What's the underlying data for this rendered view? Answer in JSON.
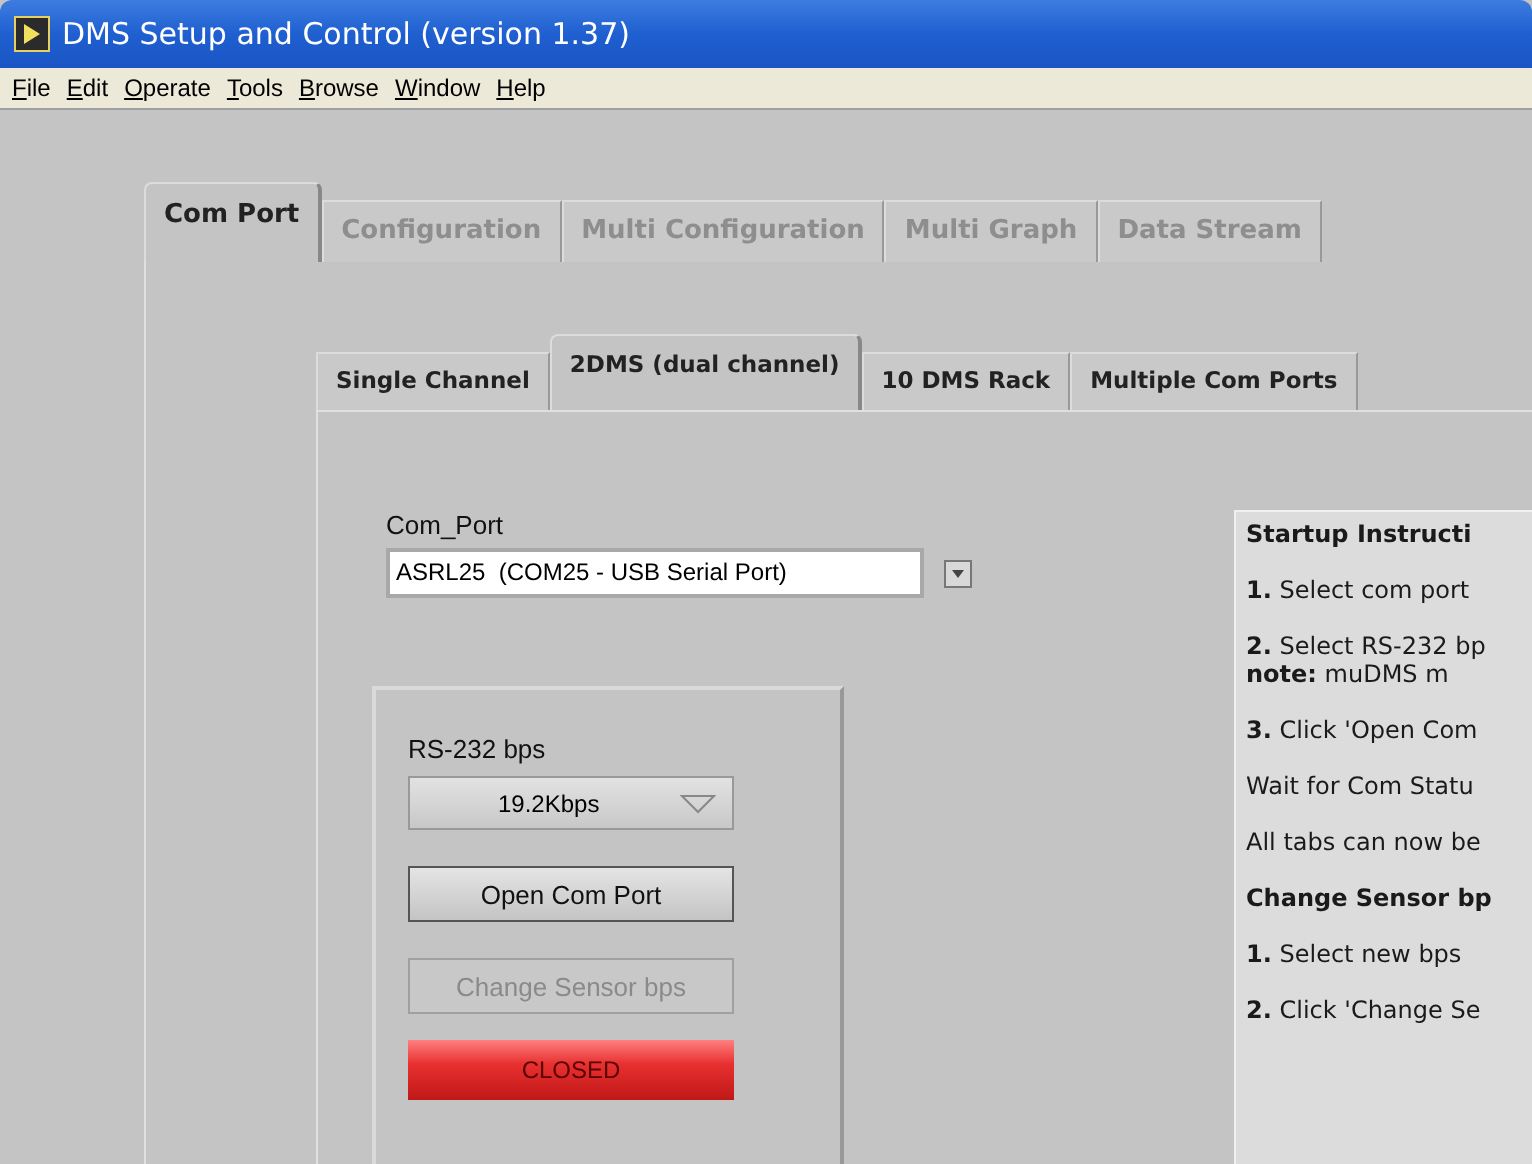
{
  "window": {
    "title": "DMS Setup and Control (version 1.37)"
  },
  "menu": [
    {
      "label": "File"
    },
    {
      "label": "Edit"
    },
    {
      "label": "Operate"
    },
    {
      "label": "Tools"
    },
    {
      "label": "Browse"
    },
    {
      "label": "Window"
    },
    {
      "label": "Help"
    }
  ],
  "tabs": [
    {
      "label": "Com Port",
      "selected": true,
      "disabled": false
    },
    {
      "label": "Configuration",
      "selected": false,
      "disabled": true
    },
    {
      "label": "Multi Configuration",
      "selected": false,
      "disabled": true
    },
    {
      "label": "Multi Graph",
      "selected": false,
      "disabled": true
    },
    {
      "label": "Data Stream",
      "selected": false,
      "disabled": true
    }
  ],
  "subtabs": [
    {
      "label": "Single Channel",
      "selected": false
    },
    {
      "label": "2DMS (dual channel)",
      "selected": true
    },
    {
      "label": "10 DMS Rack",
      "selected": false
    },
    {
      "label": "Multiple Com Ports",
      "selected": false
    }
  ],
  "com_port": {
    "label": "Com_Port",
    "value": "ASRL25  (COM25 - USB Serial Port)"
  },
  "bps": {
    "label": "RS-232 bps",
    "value": "19.2Kbps"
  },
  "buttons": [
    {
      "label": "Open Com Port",
      "disabled": false
    },
    {
      "label": "Change Sensor bps",
      "disabled": true
    }
  ],
  "status": {
    "label": "CLOSED",
    "open": false
  },
  "instructions": [
    {
      "kind": "heading",
      "text": "Startup Instructi"
    },
    {
      "kind": "line",
      "text": "**1.** Select com port"
    },
    {
      "kind": "line",
      "text": "**2.** Select RS-232 bp",
      "more": "**note:** muDMS m"
    },
    {
      "kind": "line",
      "text": "**3.** Click 'Open Com"
    },
    {
      "kind": "line",
      "text": "Wait for Com Statu"
    },
    {
      "kind": "line",
      "text": "All tabs can now be"
    },
    {
      "kind": "heading",
      "text": "Change Sensor bp"
    },
    {
      "kind": "line",
      "text": "**1.** Select new bps"
    },
    {
      "kind": "line",
      "text": "**2.** Click 'Change Se"
    }
  ]
}
